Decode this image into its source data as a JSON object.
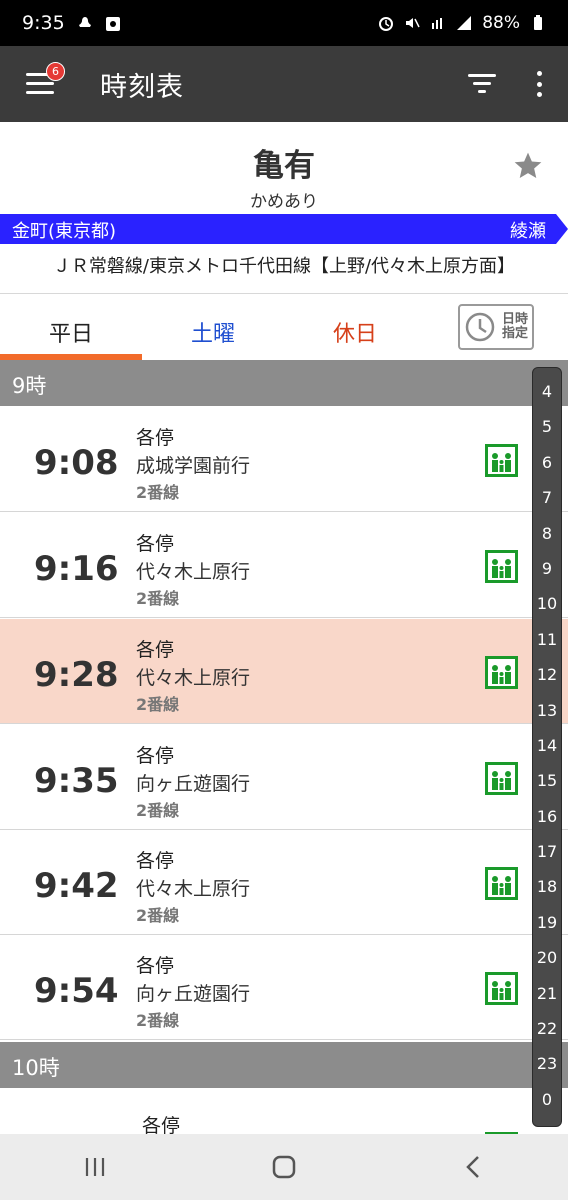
{
  "status_bar": {
    "time": "9:35",
    "battery": "88%"
  },
  "app_bar": {
    "title": "時刻表",
    "badge_count": "6"
  },
  "station": {
    "name": "亀有",
    "kana": "かめあり"
  },
  "line": {
    "from": "金町(東京都)",
    "to": "綾瀬",
    "description": "ＪＲ常磐線/東京メトロ千代田線【上野/代々木上原方面】",
    "color": "#2a22ff"
  },
  "tabs": [
    {
      "label": "平日",
      "color": "#222222"
    },
    {
      "label": "土曜",
      "color": "#1f4fd0"
    },
    {
      "label": "休日",
      "color": "#d6401a"
    }
  ],
  "date_button_label": [
    "日時",
    "指定"
  ],
  "hours": [
    {
      "label": "9時",
      "trains": [
        {
          "time": "9:08",
          "kind": "各停",
          "dest": "成城学園前行",
          "track": "2番線",
          "highlight": false
        },
        {
          "time": "9:16",
          "kind": "各停",
          "dest": "代々木上原行",
          "track": "2番線",
          "highlight": false
        },
        {
          "time": "9:28",
          "kind": "各停",
          "dest": "代々木上原行",
          "track": "2番線",
          "highlight": true
        },
        {
          "time": "9:35",
          "kind": "各停",
          "dest": "向ヶ丘遊園行",
          "track": "2番線",
          "highlight": false
        },
        {
          "time": "9:42",
          "kind": "各停",
          "dest": "代々木上原行",
          "track": "2番線",
          "highlight": false
        },
        {
          "time": "9:54",
          "kind": "各停",
          "dest": "向ヶ丘遊園行",
          "track": "2番線",
          "highlight": false
        }
      ]
    },
    {
      "label": "10時",
      "trains": [
        {
          "time": "",
          "kind": "各停",
          "dest": "",
          "track": "",
          "highlight": false
        }
      ]
    }
  ],
  "hour_index": [
    "4",
    "5",
    "6",
    "7",
    "8",
    "9",
    "10",
    "11",
    "12",
    "13",
    "14",
    "15",
    "16",
    "17",
    "18",
    "19",
    "20",
    "21",
    "22",
    "23",
    "0"
  ],
  "colors": {
    "accent": "#f26b2a",
    "highlight_row": "#f9d7c9",
    "car_icon": "#1a9a2a"
  }
}
